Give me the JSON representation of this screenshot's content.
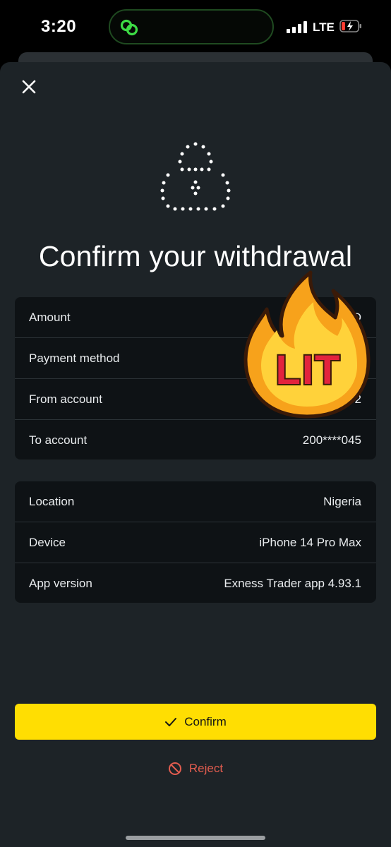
{
  "status_bar": {
    "time": "3:20",
    "network": "LTE"
  },
  "title": "Confirm your withdrawal",
  "transaction": [
    {
      "label": "Amount",
      "value": "0 USD"
    },
    {
      "label": "Payment method",
      "value": ""
    },
    {
      "label": "From account",
      "value": "52"
    },
    {
      "label": "To account",
      "value": "200****045"
    }
  ],
  "session": [
    {
      "label": "Location",
      "value": "Nigeria"
    },
    {
      "label": "Device",
      "value": "iPhone 14 Pro Max"
    },
    {
      "label": "App version",
      "value": "Exness Trader app 4.93.1"
    }
  ],
  "actions": {
    "confirm_label": "Confirm",
    "reject_label": "Reject"
  },
  "sticker": {
    "text": "LIT"
  },
  "colors": {
    "accent": "#ffde02",
    "danger": "#e25c4f",
    "sheet": "#1d2327",
    "card": "#0e1215",
    "island_icon": "#3ddc45"
  },
  "icons": [
    "link-icon",
    "signal-icon",
    "battery-icon",
    "close-icon",
    "padlock-icon",
    "checkmark-icon",
    "block-icon",
    "fire-icon"
  ]
}
